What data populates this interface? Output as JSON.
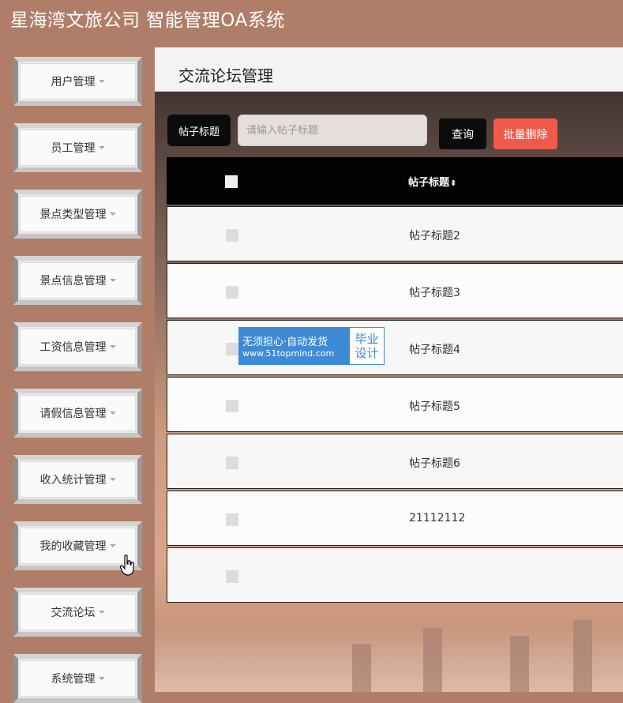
{
  "app": {
    "title": "星海湾文旅公司 智能管理OA系统"
  },
  "sidebar": {
    "items": [
      {
        "label": "用户管理"
      },
      {
        "label": "员工管理"
      },
      {
        "label": "景点类型管理"
      },
      {
        "label": "景点信息管理"
      },
      {
        "label": "工资信息管理"
      },
      {
        "label": "请假信息管理"
      },
      {
        "label": "收入统计管理"
      },
      {
        "label": "我的收藏管理"
      },
      {
        "label": "交流论坛"
      },
      {
        "label": "系统管理"
      }
    ]
  },
  "main": {
    "title": "交流论坛管理",
    "search": {
      "label": "帖子标题",
      "placeholder": "请输入帖子标题",
      "value": ""
    },
    "buttons": {
      "query": "查询",
      "batch_delete": "批量删除"
    },
    "table": {
      "header": {
        "title": "帖子标题",
        "sort_glyph": "⬍"
      },
      "rows": [
        {
          "title": "帖子标题2"
        },
        {
          "title": "帖子标题3"
        },
        {
          "title": "帖子标题4"
        },
        {
          "title": "帖子标题5"
        },
        {
          "title": "帖子标题6"
        },
        {
          "title": "21112112"
        },
        {
          "title": ""
        }
      ]
    }
  },
  "watermark": {
    "line1": "无须担心·自动发货",
    "line2": "www.51topmind.com",
    "right1": "毕业",
    "right2": "设计"
  },
  "colors": {
    "sidebar_bg": "#b07e68",
    "danger": "#f05a4a",
    "dark": "#0b0b0b",
    "watermark_blue": "#3f8ad6"
  },
  "icons": {
    "caret": "chevron-down-icon",
    "cursor": "hand-pointer-icon"
  }
}
